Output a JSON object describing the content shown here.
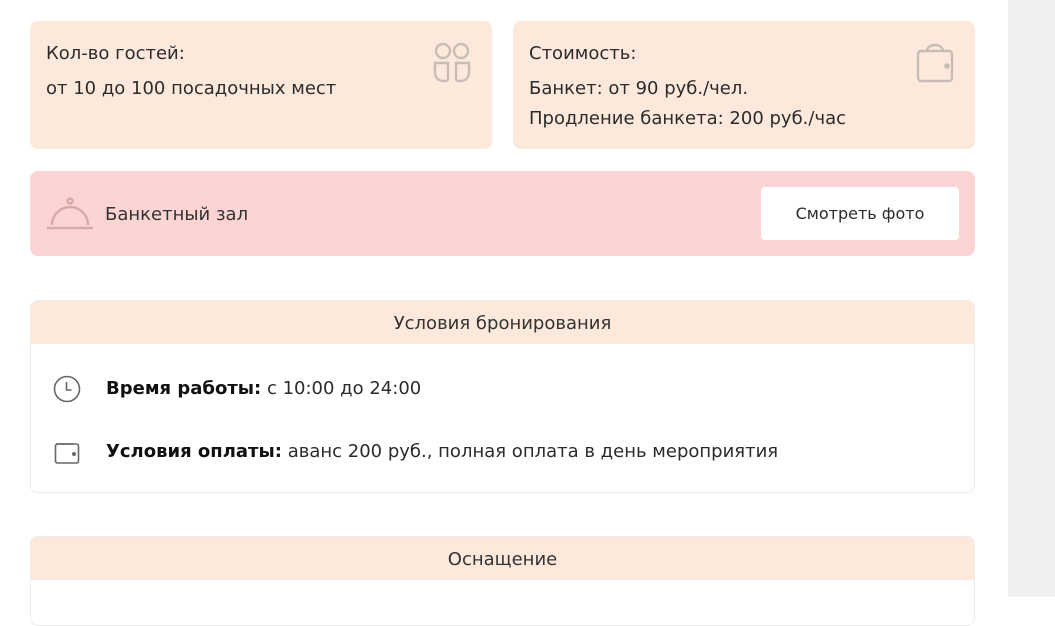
{
  "guests_card": {
    "label": "Кол-во гостей:",
    "value": "от 10 до 100 посадочных мест",
    "icon": "guests-icon"
  },
  "price_card": {
    "label": "Стоимость:",
    "banquet": "Банкет: от 90 руб./чел.",
    "extension": "Продление банкета: 200 руб./час",
    "icon": "wallet-bag-icon"
  },
  "hall": {
    "icon": "cloche-icon",
    "name": "Банкетный зал",
    "photo_button": "Смотреть фото"
  },
  "booking": {
    "title": "Условия бронирования",
    "hours_label": "Время работы:",
    "hours_value": " с 10:00 до 24:00",
    "hours_icon": "clock-icon",
    "payment_label": "Условия оплаты:",
    "payment_value": " аванс 200 руб., полная оплата в день мероприятия",
    "payment_icon": "wallet-icon"
  },
  "equipment": {
    "title": "Оснащение"
  },
  "colors": {
    "card_bg": "#fde9dc",
    "hall_bg": "#fdd4d4",
    "icon_gray": "#bdbdbd",
    "gutter": "#f0f0f0"
  }
}
